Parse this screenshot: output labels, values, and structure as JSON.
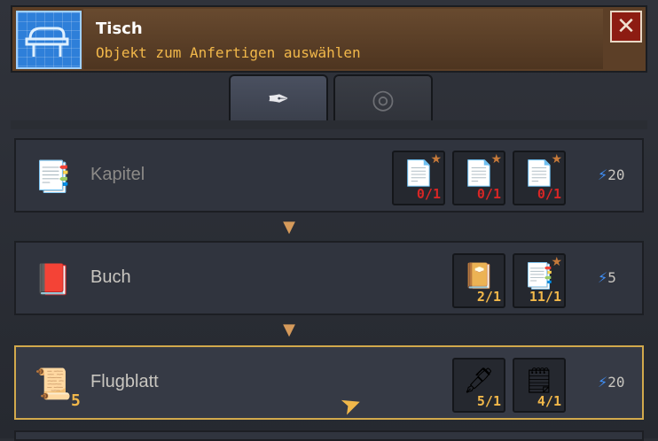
{
  "header": {
    "title": "Tisch",
    "subtitle": "Objekt zum Anfertigen auswählen",
    "icon": "blueprint-table-icon",
    "close_label": "✕"
  },
  "tabs": [
    {
      "icon": "quill-paper-icon",
      "active": true
    },
    {
      "icon": "spiral-shell-icon",
      "active": false
    }
  ],
  "rows": [
    {
      "name": "Kapitel",
      "icon": "stacked-pages-icon",
      "energy": "20",
      "ingredients": [
        {
          "icon": "paper-sheets-icon",
          "count": "0/1"
        },
        {
          "icon": "paper-sheets-icon",
          "count": "0/1"
        },
        {
          "icon": "paper-sheets-icon",
          "count": "0/1"
        }
      ]
    },
    {
      "name": "Buch",
      "icon": "book-icon",
      "energy": "5",
      "ingredients": [
        {
          "icon": "leather-binding-icon",
          "count": "2/1"
        },
        {
          "icon": "stacked-pages-icon",
          "count": "11/1"
        }
      ]
    },
    {
      "name": "Flugblatt",
      "icon": "scroll-icon",
      "quantity": "5",
      "energy": "20",
      "ingredients": [
        {
          "icon": "ink-bottle-icon",
          "count": "5/1"
        },
        {
          "icon": "blank-paper-icon",
          "count": "4/1"
        }
      ]
    }
  ],
  "colors": {
    "accent_gold": "#f2b84a",
    "shortfall_red": "#d82626",
    "energy_blue": "#3f8ef5",
    "selection_border": "#d2a94c"
  }
}
